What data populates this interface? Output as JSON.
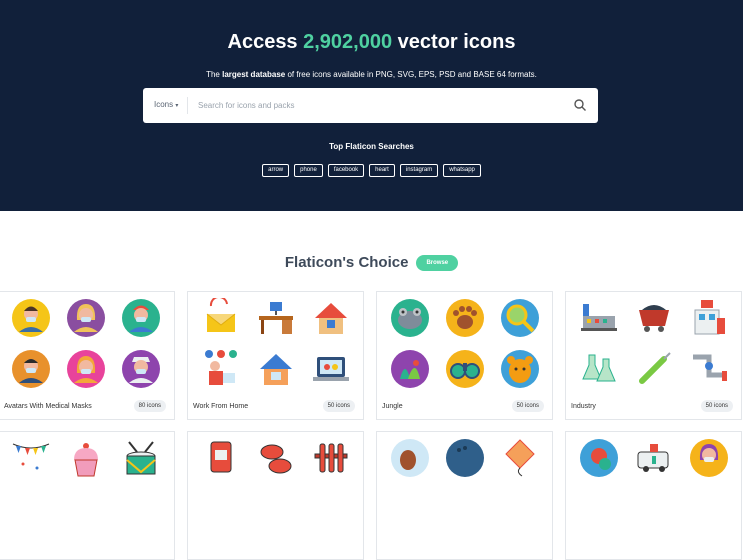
{
  "hero": {
    "title_pre": "Access ",
    "title_count": "2,902,000",
    "title_post": " vector icons",
    "sub_pre": "The ",
    "sub_bold": "largest database",
    "sub_post": " of free icons available in PNG, SVG, EPS, PSD and BASE 64 formats."
  },
  "search": {
    "select_value": "Icons",
    "placeholder": "Search for icons and packs"
  },
  "top_searches": {
    "title": "Top Flaticon Searches",
    "tags": [
      "arrow",
      "phone",
      "facebook",
      "heart",
      "instagram",
      "whatsapp"
    ]
  },
  "choice": {
    "title": "Flaticon's Choice",
    "browse_label": "Browse"
  },
  "packs": [
    {
      "name": "Avatars With Medical Masks",
      "count": "80 icons"
    },
    {
      "name": "Work From Home",
      "count": "50 icons"
    },
    {
      "name": "Jungle",
      "count": "50 icons"
    },
    {
      "name": "Industry",
      "count": "50 icons"
    }
  ],
  "colors": {
    "hero_bg": "#11203a",
    "accent": "#4fd1a1"
  }
}
